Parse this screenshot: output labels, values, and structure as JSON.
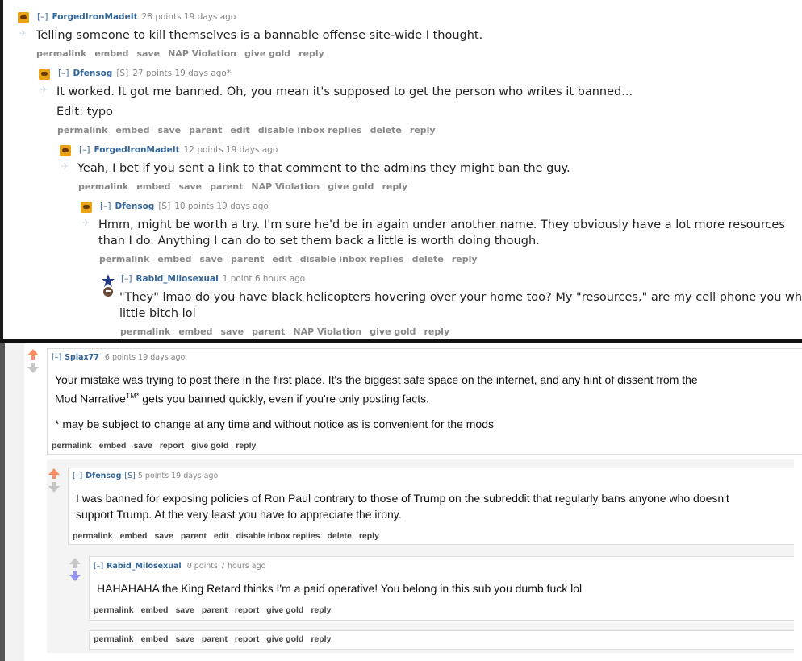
{
  "top": {
    "c1": {
      "toggle": "[–]",
      "author": "ForgedIronMadeIt",
      "score": "28 points",
      "time": "19 days ago",
      "body": "Telling someone to kill themselves is a bannable offense site-wide I thought.",
      "buttons": [
        "permalink",
        "embed",
        "save",
        "NAP Violation",
        "give gold",
        "reply"
      ]
    },
    "c2": {
      "toggle": "[–]",
      "author": "Dfensog",
      "sub": "[S]",
      "score": "27 points",
      "time": "19 days ago*",
      "body": "It worked. It got me banned. Oh, you mean it's supposed to get the person who writes it banned...",
      "body_b": "Edit: typo",
      "buttons": [
        "permalink",
        "embed",
        "save",
        "parent",
        "edit",
        "disable inbox replies",
        "delete",
        "reply"
      ]
    },
    "c3": {
      "toggle": "[–]",
      "author": "ForgedIronMadeIt",
      "score": "12 points",
      "time": "19 days ago",
      "body": "Yeah, I bet if you sent a link to that comment to the admins they might ban the guy.",
      "buttons": [
        "permalink",
        "embed",
        "save",
        "parent",
        "NAP Violation",
        "give gold",
        "reply"
      ]
    },
    "c4": {
      "toggle": "[–]",
      "author": "Dfensog",
      "sub": "[S]",
      "score": "10 points",
      "time": "19 days ago",
      "body_a": "Hmm, might be worth a try. I'm sure he'd be in again under another name. They obviously have a lot more resources",
      "body_b": "than I do. Anything I can do to set them back a little is worth doing though.",
      "buttons": [
        "permalink",
        "embed",
        "save",
        "parent",
        "edit",
        "disable inbox replies",
        "delete",
        "reply"
      ]
    },
    "c5": {
      "toggle": "[–]",
      "author": "Rabid_Milosexual",
      "score": "1 point",
      "time": "6 hours ago",
      "body_a": "\"They\" lmao do you have black helicopters hovering over your home too? My \"resources,\" are my cell phone you whiny",
      "body_b": "little bitch lol",
      "buttons": [
        "permalink",
        "embed",
        "save",
        "parent",
        "NAP Violation",
        "give gold",
        "reply"
      ]
    }
  },
  "bottom": {
    "d1": {
      "toggle": "[–]",
      "author": "Splax77",
      "score": "6 points",
      "time": "19 days ago",
      "body_a": "Your mistake was trying to post there in the first place. It's the biggest safe space on the internet, and any hint of dissent from the",
      "body_b_pre": "Mod Narrative",
      "body_b_sup": "TM*",
      "body_b_post": " gets you banned quickly, even if you're only posting facts.",
      "body_c": "* may be subject to change at any time and without notice as is convenient for the mods",
      "buttons": [
        "permalink",
        "embed",
        "save",
        "report",
        "give gold",
        "reply"
      ]
    },
    "d2": {
      "toggle": "[–]",
      "author": "Dfensog",
      "sub": "[S]",
      "score": "5 points",
      "time": "19 days ago",
      "body_a": "I was banned for exposing policies of Ron Paul contrary to those of Trump on the subreddit that regularly bans anyone who doesn't",
      "body_b": "support Trump. At the very least you have to appreciate the irony.",
      "buttons": [
        "permalink",
        "embed",
        "save",
        "parent",
        "edit",
        "disable inbox replies",
        "delete",
        "reply"
      ]
    },
    "d3": {
      "toggle": "[–]",
      "author": "Rabid_Milosexual",
      "score": "0 points",
      "time": "7 hours ago",
      "body": "HAHAHAHA the King Retard thinks I'm a paid operative! You belong in this sub you dumb fuck lol",
      "buttons": [
        "permalink",
        "embed",
        "save",
        "parent",
        "report",
        "give gold",
        "reply"
      ]
    },
    "d4": {
      "buttons": [
        "permalink",
        "embed",
        "save",
        "parent",
        "report",
        "give gold",
        "reply"
      ]
    }
  },
  "colors": {
    "link": "#336699",
    "upvote": "#ff8b60",
    "downvote": "#9494ff",
    "neutral": "#c6c6c6"
  }
}
